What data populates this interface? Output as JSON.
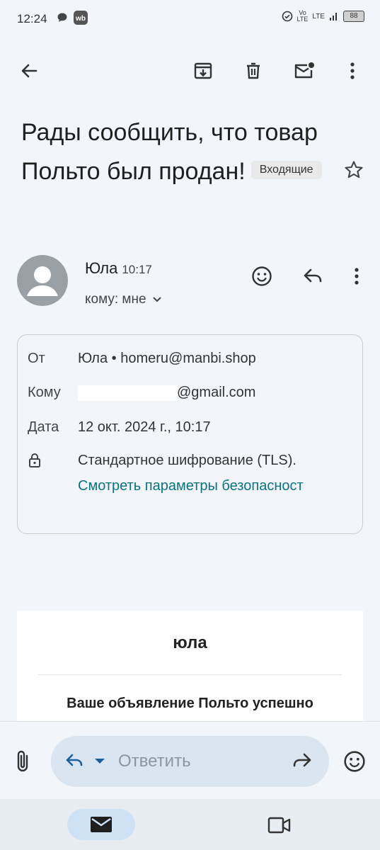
{
  "status_bar": {
    "time": "12:24",
    "net_label_top": "Vo",
    "net_label_bottom": "LTE",
    "lte_label": "LTE",
    "battery": "88"
  },
  "email": {
    "subject": "Рады сообщить, что товар Польто был продан!",
    "label": "Входящие",
    "sender_name": "Юла",
    "sender_time": "10:17",
    "to_me": "кому: мне"
  },
  "details": {
    "from_key": "От",
    "from_value": "Юла • homeru@manbi.shop",
    "to_key": "Кому",
    "to_value": "@gmail.com",
    "date_key": "Дата",
    "date_value": "12 окт. 2024 г., 10:17",
    "encryption": "Стандартное шифрование (TLS).",
    "security_link": "Смотреть параметры безопасност"
  },
  "body": {
    "brand": "юла",
    "headline": "Ваше объявление Польто успешно"
  },
  "reply": {
    "placeholder": "Ответить"
  },
  "colors": {
    "background": "#f2f6fb",
    "link": "#0b7285",
    "reply_pill": "#d9e5f1",
    "nav_active": "#cfe1f5"
  }
}
